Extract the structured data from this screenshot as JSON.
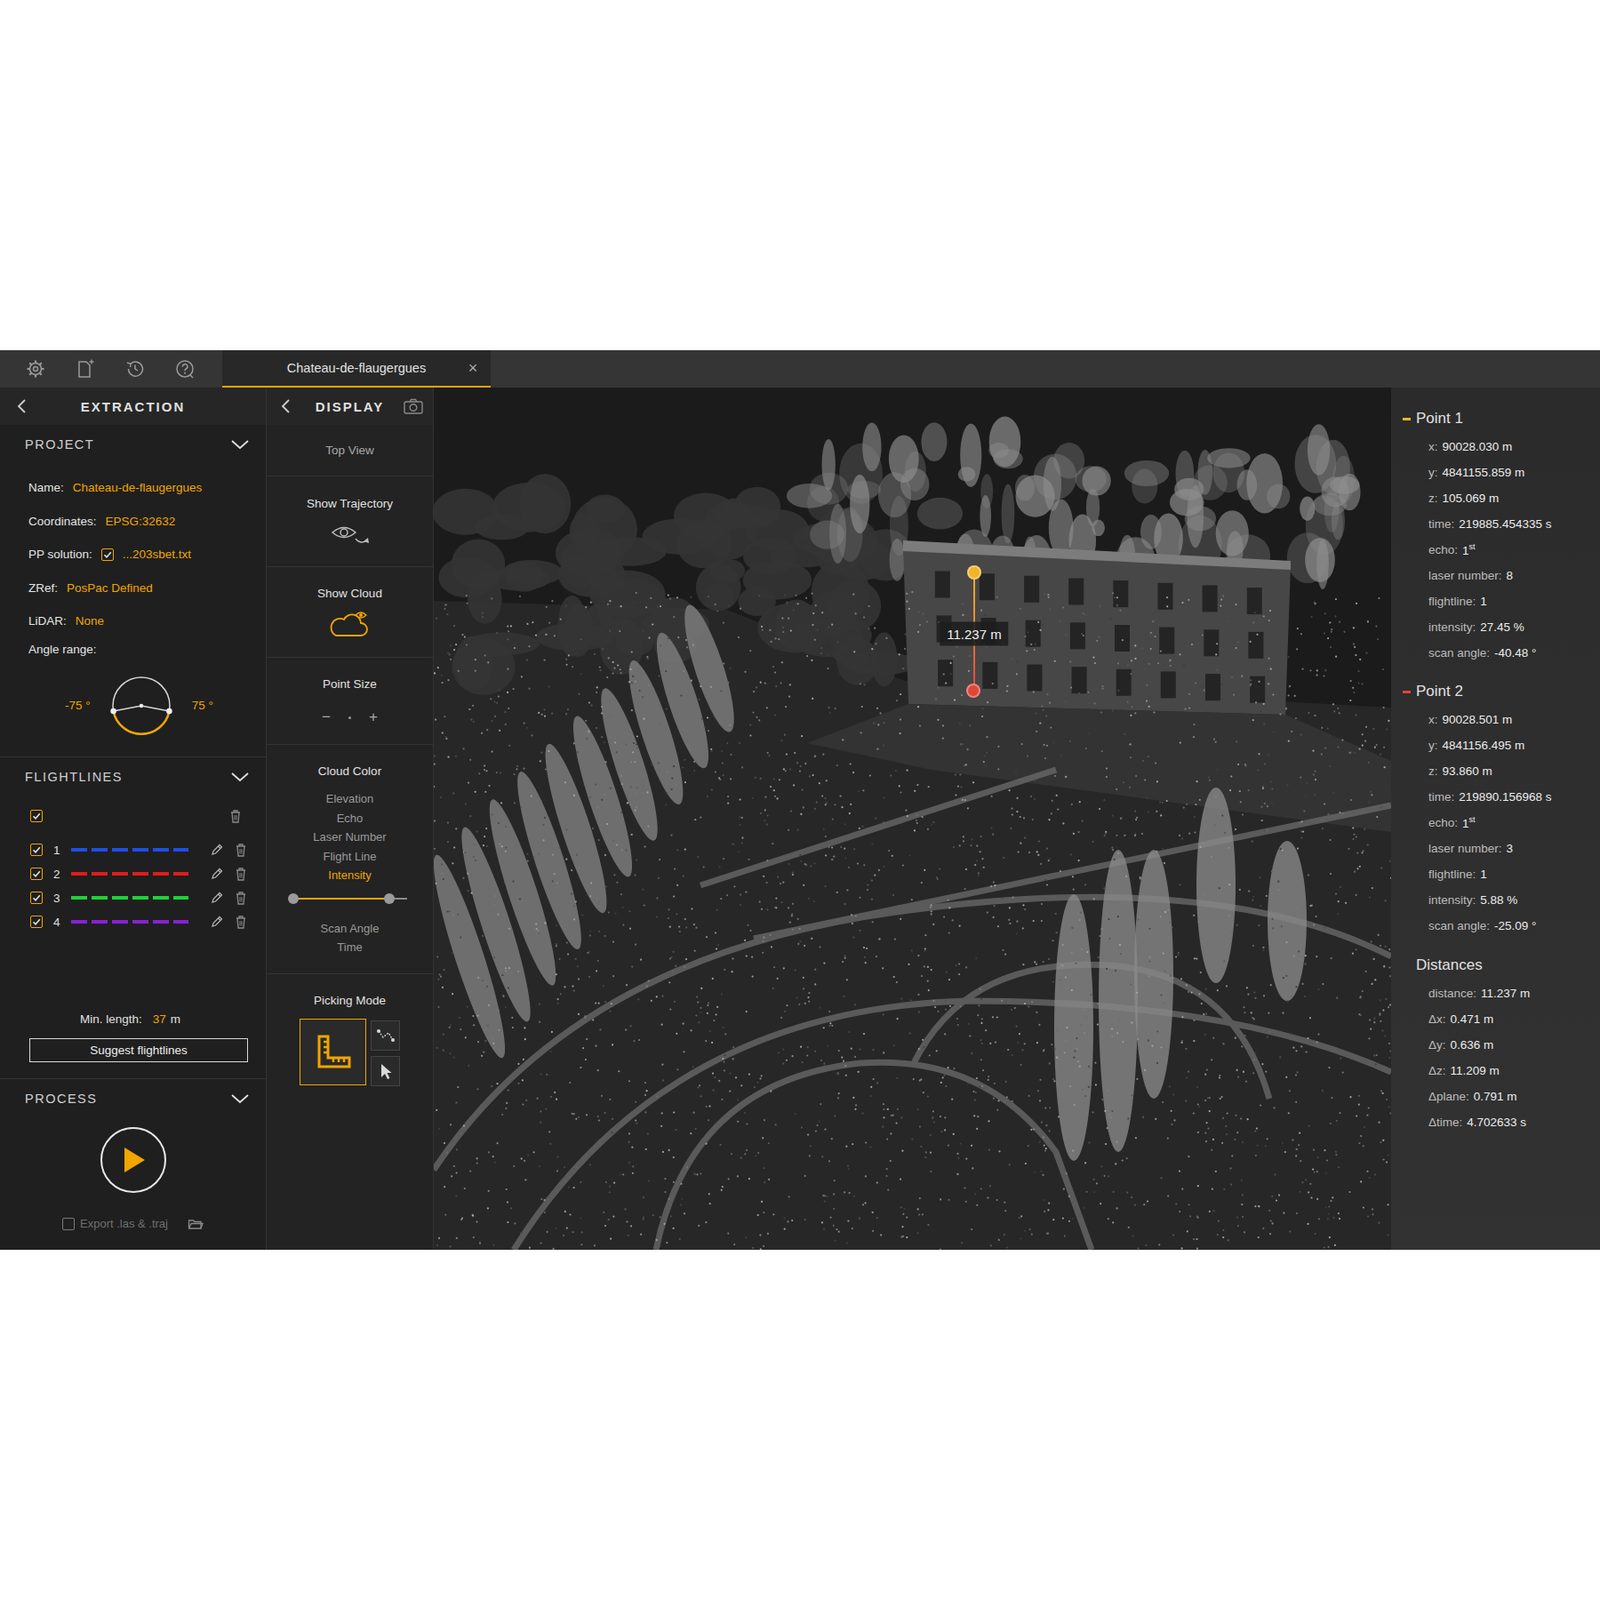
{
  "tabs": [
    {
      "label": "Chateau-de-flaugergues",
      "close": "×",
      "selected": true
    }
  ],
  "extraction": {
    "title": "EXTRACTION",
    "project": {
      "title": "PROJECT",
      "expanded": true,
      "fields": [
        {
          "kind": "text",
          "label": "Name:",
          "value": "Chateau-de-flaugergues"
        },
        {
          "kind": "text",
          "label": "Coordinates:",
          "value": "EPSG:32632"
        },
        {
          "kind": "check",
          "label": "PP solution:",
          "value": "...203sbet.txt",
          "checked": true
        },
        {
          "kind": "text",
          "label": "ZRef:",
          "value": "PosPac Defined"
        },
        {
          "kind": "text",
          "label": "LiDAR:",
          "value": "None"
        }
      ],
      "angle_range": {
        "label": "Angle range:",
        "min": "-75 °",
        "max": "75 °"
      }
    },
    "flightlines": {
      "title": "FLIGHTLINES",
      "expanded": true,
      "all_checked": true,
      "lines": [
        {
          "number": "1",
          "checked": true,
          "color": "#1e4fe6"
        },
        {
          "number": "2",
          "checked": true,
          "color": "#e01b1b"
        },
        {
          "number": "3",
          "checked": true,
          "color": "#1fd13a"
        },
        {
          "number": "4",
          "checked": true,
          "color": "#8a1fd6"
        }
      ],
      "min_length": {
        "label": "Min. length:",
        "value": "37",
        "unit": "m"
      },
      "suggest_button": "Suggest flightlines"
    },
    "process": {
      "title": "PROCESS",
      "expanded": true,
      "export": {
        "label": "Export .las & .traj",
        "checked": false
      }
    }
  },
  "display": {
    "title": "DISPLAY",
    "top_view": "Top View",
    "show_trajectory": {
      "label": "Show Trajectory",
      "on": false
    },
    "show_cloud": {
      "label": "Show Cloud",
      "on": true
    },
    "point_size": {
      "label": "Point Size",
      "minus": "−",
      "plus": "+"
    },
    "cloud_color": {
      "label": "Cloud Color",
      "options": [
        {
          "label": "Elevation",
          "selected": false
        },
        {
          "label": "Echo",
          "selected": false
        },
        {
          "label": "Laser Number",
          "selected": false
        },
        {
          "label": "Flight Line",
          "selected": false
        },
        {
          "label": "Intensity",
          "selected": true
        },
        {
          "label": "Scan Angle",
          "selected": false
        },
        {
          "label": "Time",
          "selected": false
        }
      ],
      "range": {
        "low": 0,
        "high": 0.85
      }
    },
    "picking_mode": {
      "label": "Picking Mode",
      "modes": [
        {
          "kind": "ruler",
          "selected": true
        },
        {
          "kind": "path",
          "selected": false
        },
        {
          "kind": "pointer",
          "selected": false
        }
      ]
    }
  },
  "viewport": {
    "measure_label": "11.237 m"
  },
  "info": {
    "points": [
      {
        "title": "Point 1",
        "color": "#f0b429",
        "rows": [
          {
            "label": "x:",
            "value": "90028.030 m"
          },
          {
            "label": "y:",
            "value": "4841155.859 m"
          },
          {
            "label": "z:",
            "value": "105.069 m"
          },
          {
            "label": "time:",
            "value": "219885.454335 s"
          },
          {
            "label": "echo:",
            "value": "1",
            "sup": "st"
          },
          {
            "label": "laser number:",
            "value": "8"
          },
          {
            "label": "flightline:",
            "value": "1"
          },
          {
            "label": "intensity:",
            "value": "27.45 %"
          },
          {
            "label": "scan angle:",
            "value": "-40.48 °"
          }
        ]
      },
      {
        "title": "Point 2",
        "color": "#e0463a",
        "rows": [
          {
            "label": "x:",
            "value": "90028.501 m"
          },
          {
            "label": "y:",
            "value": "4841156.495 m"
          },
          {
            "label": "z:",
            "value": "93.860 m"
          },
          {
            "label": "time:",
            "value": "219890.156968 s"
          },
          {
            "label": "echo:",
            "value": "1",
            "sup": "st"
          },
          {
            "label": "laser number:",
            "value": "3"
          },
          {
            "label": "flightline:",
            "value": "1"
          },
          {
            "label": "intensity:",
            "value": "5.88 %"
          },
          {
            "label": "scan angle:",
            "value": "-25.09 °"
          }
        ]
      }
    ],
    "distances": {
      "title": "Distances",
      "rows": [
        {
          "label": "distance:",
          "value": "11.237 m"
        },
        {
          "label": "Δx:",
          "value": "0.471 m"
        },
        {
          "label": "Δy:",
          "value": "0.636 m"
        },
        {
          "label": "Δz:",
          "value": "11.209 m"
        },
        {
          "label": "Δplane:",
          "value": "0.791 m"
        },
        {
          "label": "Δtime:",
          "value": "4.702633 s"
        }
      ]
    }
  }
}
